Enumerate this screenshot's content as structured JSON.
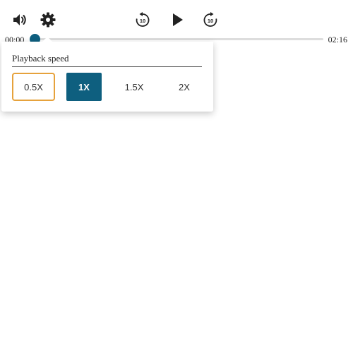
{
  "player": {
    "time_current": "00:00",
    "time_total": "02:16",
    "progress_fraction": 0.0
  },
  "controls": {
    "volume_icon": "volume-icon",
    "settings_icon": "gear-icon",
    "rewind_icon": "rewind-10-icon",
    "play_icon": "play-icon",
    "forward_icon": "forward-10-icon"
  },
  "speed_popup": {
    "title": "Playback speed",
    "options": [
      {
        "label": "0.5X",
        "state": "focused"
      },
      {
        "label": "1X",
        "state": "selected"
      },
      {
        "label": "1.5X",
        "state": "normal"
      },
      {
        "label": "2X",
        "state": "normal"
      }
    ]
  },
  "colors": {
    "accent": "#0e5f7f",
    "focus_ring": "#e6a23c",
    "track": "#dddddd"
  }
}
